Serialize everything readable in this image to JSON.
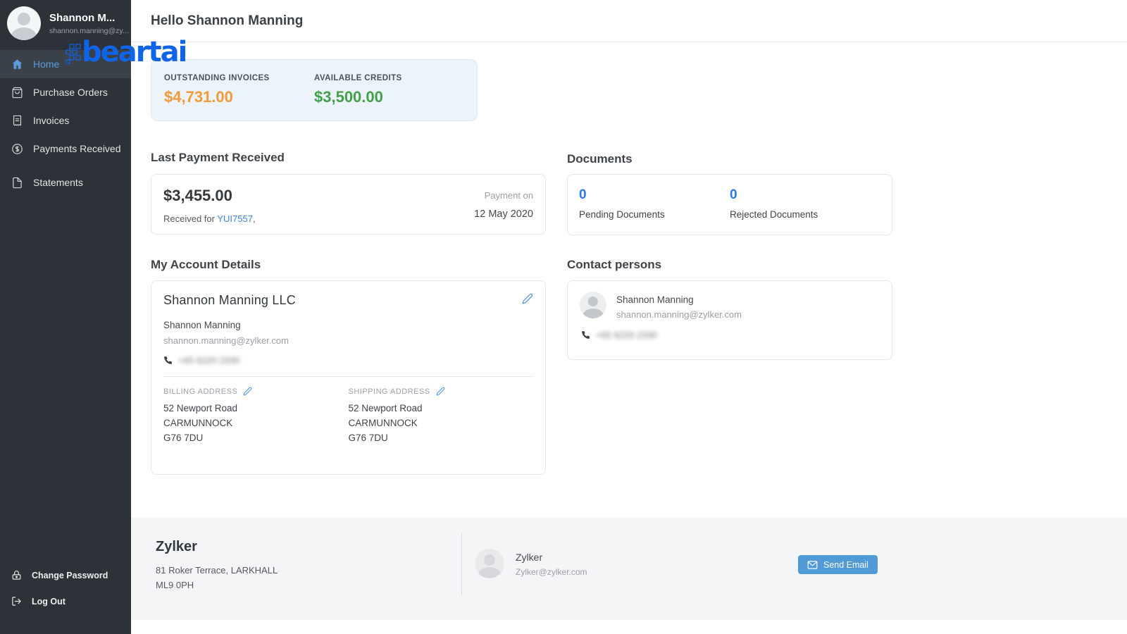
{
  "colors": {
    "sidebar_bg": "#2c3237",
    "accent_blue": "#2878f0",
    "link_blue": "#3f82d6",
    "orange": "#f09b38",
    "green": "#43a049",
    "summary_card_bg": "#ecf3fb",
    "footer_bg": "#f4f5f7",
    "button_blue": "#4f9ad7",
    "watermark_blue": "#1064e8"
  },
  "icons": [
    "user-avatar-icon",
    "home-icon",
    "purchase-orders-bag-icon",
    "invoices-receipt-icon",
    "payments-dollar-icon",
    "statements-file-icon",
    "lock-icon",
    "logout-icon",
    "edit-pencil-icon",
    "phone-icon",
    "envelope-icon",
    "qr-pattern-icon"
  ],
  "watermark": {
    "text": "beartai"
  },
  "sidebar": {
    "user": {
      "name": "Shannon M...",
      "email": "shannon.manning@zy..."
    },
    "items": [
      {
        "label": "Home",
        "active": true
      },
      {
        "label": "Purchase Orders",
        "active": false
      },
      {
        "label": "Invoices",
        "active": false
      },
      {
        "label": "Payments Received",
        "active": false
      },
      {
        "label": "Statements",
        "active": false
      }
    ],
    "footer_items": [
      {
        "label": "Change Password"
      },
      {
        "label": "Log Out"
      }
    ]
  },
  "header": {
    "greeting": "Hello Shannon Manning"
  },
  "summary": {
    "outstanding_label": "OUTSTANDING INVOICES",
    "outstanding_value": "$4,731.00",
    "credits_label": "AVAILABLE CREDITS",
    "credits_value": "$3,500.00"
  },
  "last_payment": {
    "section_title": "Last Payment Received",
    "amount": "$3,455.00",
    "received_prefix": "Received for ",
    "reference": "YUI7557",
    "received_suffix": ",",
    "payment_on_label": "Payment on",
    "payment_date": "12 May 2020"
  },
  "documents": {
    "section_title": "Documents",
    "pending_count": "0",
    "pending_label": "Pending Documents",
    "rejected_count": "0",
    "rejected_label": "Rejected Documents"
  },
  "account": {
    "section_title": "My Account Details",
    "company": "Shannon Manning LLC",
    "contact_name": "Shannon Manning",
    "email": "shannon.manning@zylker.com",
    "phone_blurred": "+65 6220 2330",
    "billing_label": "BILLING ADDRESS",
    "shipping_label": "SHIPPING ADDRESS",
    "billing_address": [
      "52 Newport Road",
      "CARMUNNOCK",
      "G76 7DU"
    ],
    "shipping_address": [
      "52 Newport Road",
      "CARMUNNOCK",
      "G76 7DU"
    ]
  },
  "contacts": {
    "section_title": "Contact persons",
    "name": "Shannon Manning",
    "email": "shannon.manning@zylker.com",
    "phone_blurred": "+65 6220 2330"
  },
  "footer": {
    "org_name": "Zylker",
    "address_line1": "81 Roker Terrace, LARKHALL",
    "address_line2": "ML9 0PH",
    "contact_name": "Zylker",
    "contact_email": "Zylker@zylker.com",
    "send_email_label": "Send Email"
  }
}
